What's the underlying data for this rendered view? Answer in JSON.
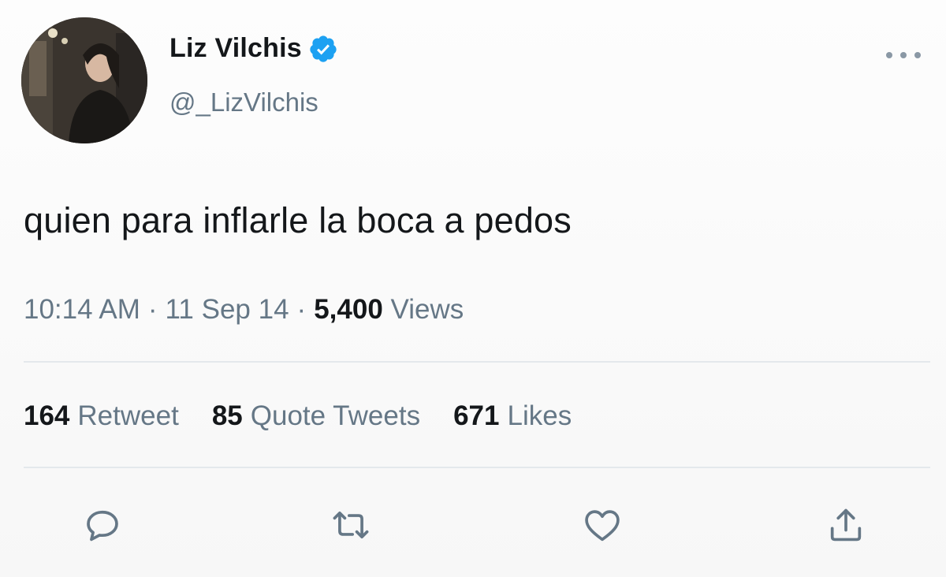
{
  "author": {
    "display_name": "Liz Vilchis",
    "handle": "@_LizVilchis",
    "verified": true
  },
  "tweet": {
    "text": "quien para inflarle la boca a pedos"
  },
  "meta": {
    "time": "10:14 AM",
    "separator": "·",
    "date": "11 Sep 14",
    "views_count": "5,400",
    "views_label": "Views"
  },
  "stats": {
    "retweets_count": "164",
    "retweets_label": "Retweet",
    "quotes_count": "85",
    "quotes_label": "Quote Tweets",
    "likes_count": "671",
    "likes_label": "Likes"
  },
  "icons": {
    "more": "more-horizontal-icon",
    "reply": "reply-icon",
    "retweet": "retweet-icon",
    "like": "heart-icon",
    "share": "share-icon",
    "verified": "verified-badge-icon"
  },
  "colors": {
    "text": "#14171a",
    "secondary": "#657786",
    "verified_blue": "#1da1f2",
    "divider": "#e4e8ec"
  }
}
